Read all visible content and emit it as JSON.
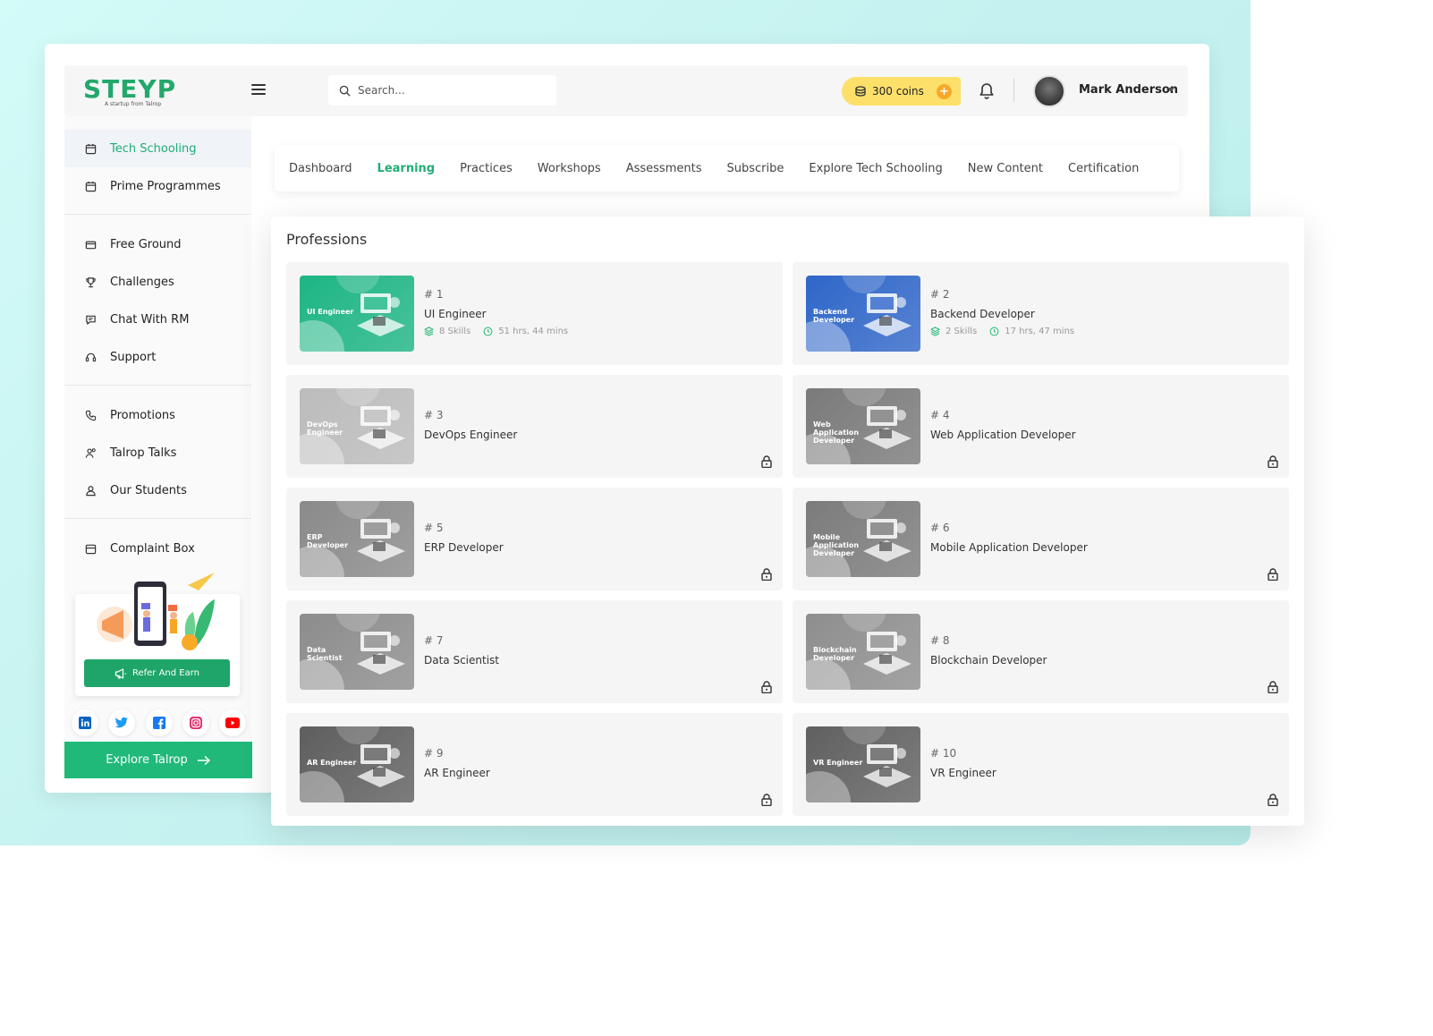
{
  "brand": {
    "logo": "STEYP",
    "tagline": "A startup from Talrop"
  },
  "search": {
    "placeholder": "Search..."
  },
  "coins": {
    "label": "300 coins",
    "plus": "+"
  },
  "user": {
    "name": "Mark Anderson"
  },
  "sidebar": {
    "group1": [
      {
        "label": "Tech Schooling",
        "icon": "calendar-icon",
        "active": true
      },
      {
        "label": "Prime Programmes",
        "icon": "calendar-icon",
        "active": false
      }
    ],
    "group2": [
      {
        "label": "Free Ground",
        "icon": "ticket-icon"
      },
      {
        "label": "Challenges",
        "icon": "trophy-icon"
      },
      {
        "label": "Chat With RM",
        "icon": "chat-icon"
      },
      {
        "label": "Support",
        "icon": "headset-icon"
      }
    ],
    "group3": [
      {
        "label": "Promotions",
        "icon": "phone-icon"
      },
      {
        "label": "Talrop Talks",
        "icon": "users-icon"
      },
      {
        "label": "Our Students",
        "icon": "user-icon"
      }
    ],
    "group4": [
      {
        "label": "Complaint Box",
        "icon": "box-icon"
      }
    ],
    "refer_label": "Refer And Earn",
    "socials": [
      "linkedin-icon",
      "twitter-icon",
      "facebook-icon",
      "instagram-icon",
      "youtube-icon"
    ],
    "explore_label": "Explore Talrop"
  },
  "tabs": [
    {
      "label": "Dashboard",
      "active": false
    },
    {
      "label": "Learning",
      "active": true
    },
    {
      "label": "Practices",
      "active": false
    },
    {
      "label": "Workshops",
      "active": false
    },
    {
      "label": "Assessments",
      "active": false
    },
    {
      "label": "Subscribe",
      "active": false
    },
    {
      "label": "Explore Tech Schooling",
      "active": false
    },
    {
      "label": "New Content",
      "active": false
    },
    {
      "label": "Certification",
      "active": false
    }
  ],
  "professions": {
    "title": "Professions",
    "items": [
      {
        "num": "# 1",
        "name": "UI Engineer",
        "thumb": "UI Engineer",
        "skills": "8 Skills",
        "time": "51 hrs, 44 mins",
        "locked": false,
        "color": "#1db584"
      },
      {
        "num": "# 2",
        "name": "Backend Developer",
        "thumb": "Backend Developer",
        "skills": "2 Skills",
        "time": "17 hrs, 47 mins",
        "locked": false,
        "color": "#2f66c9"
      },
      {
        "num": "# 3",
        "name": "DevOps Engineer",
        "thumb": "DevOps Engineer",
        "locked": true,
        "color": "#bcbcbc"
      },
      {
        "num": "# 4",
        "name": "Web Application Developer",
        "thumb": "Web Application Developer",
        "locked": true,
        "color": "#7a7a7a"
      },
      {
        "num": "# 5",
        "name": "ERP Developer",
        "thumb": "ERP Developer",
        "locked": true,
        "color": "#8a8a8a"
      },
      {
        "num": "# 6",
        "name": "Mobile Application Developer",
        "thumb": "Mobile Application Developer",
        "locked": true,
        "color": "#7b7b7b"
      },
      {
        "num": "# 7",
        "name": "Data Scientist",
        "thumb": "Data Scientist",
        "locked": true,
        "color": "#8c8c8c"
      },
      {
        "num": "# 8",
        "name": "Blockchain Developer",
        "thumb": "Blockchain Developer",
        "locked": true,
        "color": "#8e8e8e"
      },
      {
        "num": "# 9",
        "name": "AR Engineer",
        "thumb": "AR Engineer",
        "locked": true,
        "color": "#5e5e5e"
      },
      {
        "num": "# 10",
        "name": "VR Engineer",
        "thumb": "VR Engineer",
        "locked": true,
        "color": "#606060"
      }
    ]
  }
}
